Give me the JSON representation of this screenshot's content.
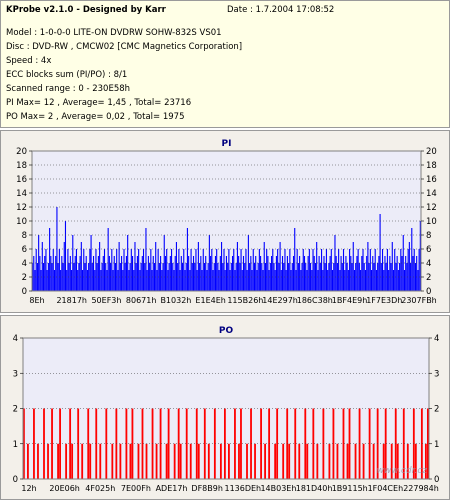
{
  "header": {
    "title": "KProbe v2.1.0 - Designed by Karr",
    "date": "Date : 1.7.2004 17:08:52",
    "lines": [
      "Model : 1-0-0-0 LITE-ON DVDRW SOHW-832S  VS01",
      "Disc : DVD-RW , CMCW02 [CMC Magnetics Corporation]",
      "Speed : 4x",
      "ECC blocks sum (PI/PO) : 8/1",
      "Scanned range : 0 - 230E58h",
      "PI Max= 12 , Average= 1,45 , Total= 23716",
      "PO Max= 2 , Average= 0,02 , Total= 1975"
    ]
  },
  "watermark": "www.cdr.cz",
  "colors": {
    "pi": "#0000ff",
    "po": "#ff0000",
    "header_bg": "#ffffe6",
    "panel_bg": "#f3f0ea",
    "plot_bg": "#ececf8"
  },
  "chart_data": [
    {
      "type": "bar",
      "title": "PI",
      "ylim": [
        0,
        20
      ],
      "yticks": [
        0,
        2,
        4,
        6,
        8,
        10,
        12,
        14,
        16,
        18,
        20
      ],
      "xticks": [
        "8Eh",
        "21817h",
        "50EF3h",
        "80671h",
        "B1032h",
        "E1E4Eh",
        "115B26h",
        "14E297h",
        "186C38h",
        "1BF4E9h",
        "1F7E3Dh",
        "2307FBh"
      ],
      "grid": true,
      "max": 12,
      "average": 1.45,
      "total": 23716,
      "values": [
        4,
        5,
        3,
        6,
        4,
        8,
        5,
        3,
        7,
        4,
        5,
        6,
        3,
        4,
        9,
        5,
        4,
        6,
        3,
        5,
        12,
        4,
        6,
        3,
        5,
        4,
        7,
        10,
        3,
        6,
        4,
        5,
        3,
        8,
        4,
        5,
        6,
        3,
        4,
        5,
        7,
        3,
        6,
        4,
        5,
        3,
        4,
        6,
        8,
        4,
        5,
        3,
        6,
        4,
        5,
        7,
        3,
        4,
        5,
        6,
        4,
        3,
        9,
        5,
        4,
        6,
        3,
        5,
        4,
        6,
        3,
        7,
        4,
        5,
        3,
        6,
        4,
        5,
        8,
        3,
        4,
        6,
        5,
        3,
        7,
        4,
        5,
        6,
        3,
        4,
        5,
        6,
        4,
        9,
        3,
        5,
        4,
        6,
        3,
        5,
        4,
        7,
        3,
        6,
        4,
        5,
        3,
        4,
        8,
        5,
        6,
        3,
        4,
        5,
        6,
        4,
        3,
        5,
        7,
        4,
        6,
        3,
        5,
        4,
        6,
        3,
        4,
        9,
        5,
        3,
        6,
        4,
        5,
        4,
        6,
        3,
        7,
        4,
        5,
        3,
        6,
        4,
        5,
        3,
        4,
        8,
        5,
        6,
        3,
        4,
        5,
        6,
        4,
        3,
        5,
        7,
        4,
        6,
        3,
        5,
        4,
        6,
        3,
        4,
        5,
        6,
        3,
        4,
        7,
        5,
        4,
        6,
        3,
        5,
        4,
        6,
        3,
        8,
        4,
        5,
        3,
        6,
        4,
        5,
        3,
        4,
        6,
        5,
        4,
        3,
        7,
        4,
        6,
        5,
        3,
        4,
        5,
        6,
        4,
        3,
        5,
        6,
        4,
        7,
        3,
        5,
        4,
        6,
        3,
        5,
        4,
        6,
        3,
        4,
        5,
        9,
        3,
        6,
        4,
        5,
        3,
        4,
        6,
        5,
        4,
        3,
        5,
        6,
        4,
        3,
        6,
        5,
        4,
        7,
        3,
        5,
        4,
        6,
        3,
        5,
        4,
        6,
        3,
        4,
        5,
        6,
        3,
        4,
        8,
        5,
        4,
        6,
        3,
        5,
        4,
        6,
        3,
        5,
        4,
        3,
        6,
        5,
        4,
        7,
        3,
        4,
        5,
        6,
        4,
        3,
        5,
        6,
        4,
        3,
        5,
        7,
        4,
        6,
        3,
        5,
        4,
        6,
        3,
        4,
        5,
        11,
        4,
        6,
        3,
        5,
        4,
        6,
        3,
        5,
        4,
        7,
        3,
        6,
        4,
        5,
        3,
        4,
        6,
        5,
        8,
        3,
        5,
        4,
        6,
        7,
        4,
        9,
        5,
        6,
        4,
        5,
        3,
        6,
        10
      ]
    },
    {
      "type": "bar",
      "title": "PO",
      "ylim": [
        0,
        4
      ],
      "yticks": [
        0,
        1,
        2,
        3,
        4
      ],
      "xticks": [
        "12h",
        "20E06h",
        "4F025h",
        "7E00Fh",
        "ADE17h",
        "DF8B9h",
        "1136DEh",
        "14B03Eh",
        "181D40h",
        "1B9115h",
        "1F04CEh",
        "227984h"
      ],
      "grid": true,
      "max": 2,
      "average": 0.02,
      "total": 1975,
      "values": [
        2,
        0,
        1,
        0,
        0,
        2,
        0,
        1,
        0,
        0,
        2,
        0,
        1,
        0,
        2,
        0,
        0,
        1,
        2,
        0,
        0,
        1,
        0,
        2,
        1,
        0,
        0,
        2,
        0,
        1,
        0,
        0,
        2,
        1,
        0,
        0,
        2,
        0,
        1,
        0,
        0,
        2,
        0,
        0,
        1,
        0,
        2,
        0,
        1,
        0,
        0,
        2,
        0,
        1,
        2,
        0,
        0,
        1,
        0,
        2,
        0,
        1,
        0,
        0,
        2,
        0,
        1,
        0,
        2,
        0,
        0,
        1,
        2,
        0,
        0,
        1,
        0,
        2,
        1,
        0,
        0,
        2,
        0,
        1,
        0,
        0,
        2,
        1,
        0,
        0,
        2,
        0,
        1,
        0,
        0,
        2,
        0,
        0,
        1,
        0,
        2,
        0,
        1,
        0,
        0,
        2,
        0,
        1,
        2,
        0,
        0,
        1,
        0,
        2,
        0,
        1,
        0,
        0,
        2,
        0,
        1,
        0,
        2,
        0,
        0,
        1,
        2,
        0,
        0,
        1,
        0,
        2,
        1,
        0,
        0,
        2,
        0,
        1,
        0,
        0,
        2,
        1,
        0,
        0,
        2,
        0,
        1,
        0,
        0,
        2,
        0,
        0,
        1,
        0,
        2,
        0,
        1,
        0,
        0,
        2,
        0,
        1,
        2,
        0,
        0,
        1,
        0,
        2,
        0,
        1,
        0,
        0,
        2,
        0,
        1,
        0,
        2,
        0,
        0,
        1,
        2,
        0,
        0,
        1,
        0,
        2,
        1,
        0,
        0,
        2,
        0,
        1,
        0,
        0,
        2,
        1,
        0,
        0,
        2,
        0,
        1,
        2
      ]
    }
  ]
}
